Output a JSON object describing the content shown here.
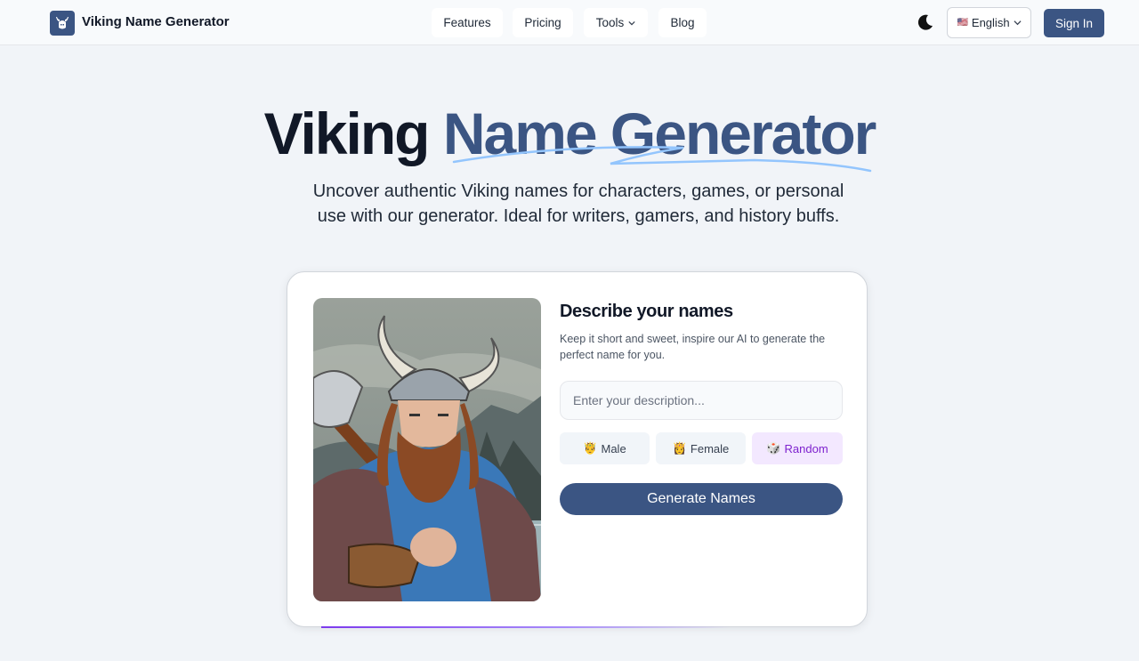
{
  "header": {
    "brand": "Viking Name Generator",
    "nav": {
      "features": "Features",
      "pricing": "Pricing",
      "tools": "Tools",
      "blog": "Blog"
    },
    "language": "English",
    "language_flag": "🇺🇸",
    "sign_in": "Sign In"
  },
  "hero": {
    "title_part1": "Viking",
    "title_part2": "Name Generator",
    "subtitle": "Uncover authentic Viking names for characters, games, or personal use with our generator. Ideal for writers, gamers, and history buffs."
  },
  "form": {
    "title": "Describe your names",
    "help": "Keep it short and sweet, inspire our AI to generate the perfect name for you.",
    "description_placeholder": "Enter your description...",
    "description_value": "",
    "gender_options": {
      "male": {
        "emoji": "🤴",
        "label": "Male"
      },
      "female": {
        "emoji": "👸",
        "label": "Female"
      },
      "random": {
        "emoji": "🎲",
        "label": "Random"
      }
    },
    "selected_gender": "Random",
    "generate_label": "Generate Names"
  },
  "colors": {
    "primary": "#3b5583",
    "accent_purple": "#7e22ce",
    "background": "#f1f4f8"
  },
  "icons": {
    "logo": "viking-helmet-icon",
    "theme": "moon-icon",
    "chevron": "chevron-down-icon"
  }
}
